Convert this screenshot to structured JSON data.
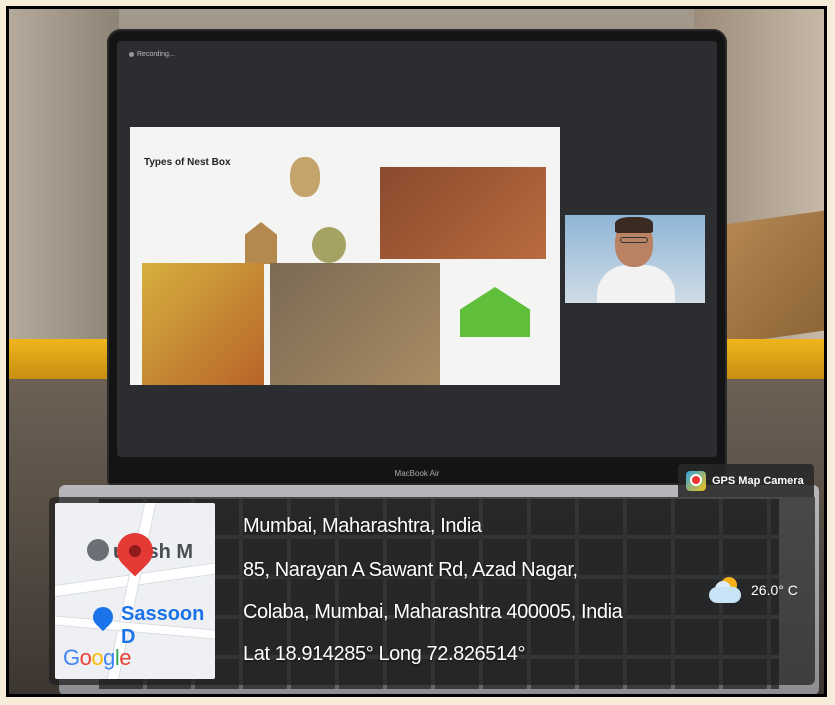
{
  "screen": {
    "recording_label": "Recording...",
    "slide_title": "Types of Nest Box",
    "device_label": "MacBook Air"
  },
  "badge": {
    "app_name": "GPS Map Camera",
    "icon": "gps-map-camera-icon"
  },
  "map": {
    "label_1": "ukesh M",
    "label_2": "Sassoon D",
    "logo": "Google"
  },
  "location": {
    "city": "Mumbai, Maharashtra, India",
    "address_line_1": "85, Narayan A Sawant Rd, Azad Nagar,",
    "address_line_2": "Colaba, Mumbai, Maharashtra 400005, India",
    "coordinates": "Lat 18.914285° Long 72.826514°"
  },
  "weather": {
    "icon": "partly-cloudy-icon",
    "temperature": "26.0° C"
  }
}
